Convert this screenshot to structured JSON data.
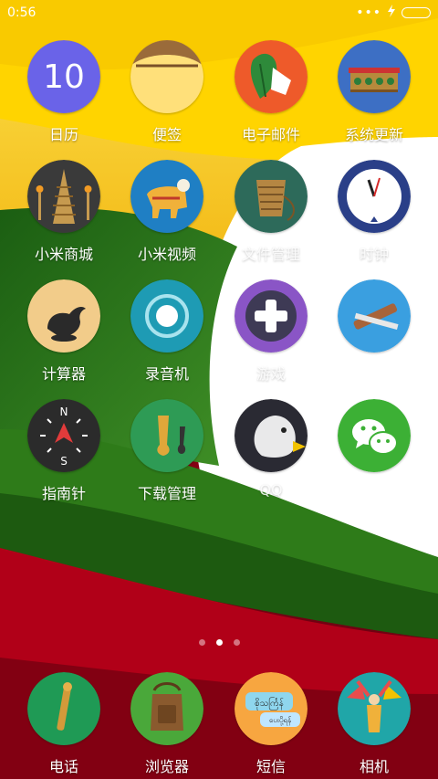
{
  "status_bar": {
    "time": "0:56",
    "overflow_dots": "•••"
  },
  "pages": {
    "count": 3,
    "active_index": 1
  },
  "apps": [
    {
      "id": "calendar",
      "label": "日历",
      "icon_text": "10"
    },
    {
      "id": "notes",
      "label": "便签"
    },
    {
      "id": "email",
      "label": "电子邮件"
    },
    {
      "id": "updater",
      "label": "系统更新"
    },
    {
      "id": "mi-store",
      "label": "小米商城"
    },
    {
      "id": "mi-video",
      "label": "小米视频"
    },
    {
      "id": "file-manager",
      "label": "文件管理"
    },
    {
      "id": "clock",
      "label": "时钟"
    },
    {
      "id": "calculator",
      "label": "计算器"
    },
    {
      "id": "recorder",
      "label": "录音机"
    },
    {
      "id": "games",
      "label": "游戏"
    },
    {
      "id": "unnamed-tools",
      "label": ""
    },
    {
      "id": "compass",
      "label": "指南针",
      "icon_letters": {
        "n": "N",
        "s": "S"
      }
    },
    {
      "id": "downloads",
      "label": "下载管理"
    },
    {
      "id": "qq",
      "label": "QQ"
    },
    {
      "id": "wechat",
      "label": ""
    }
  ],
  "dock": [
    {
      "id": "phone",
      "label": "电话"
    },
    {
      "id": "browser",
      "label": "浏览器"
    },
    {
      "id": "messages",
      "label": "短信",
      "icon_text_top": "စိုသင်္ကြန်",
      "icon_text_bottom": "ပေးပို့ရန်"
    },
    {
      "id": "camera",
      "label": "相机"
    }
  ],
  "colors": {
    "wallpaper_yellow": "#f7c200",
    "wallpaper_green": "#2f7d1a",
    "wallpaper_red": "#a8001a",
    "wallpaper_white": "#ffffff"
  }
}
